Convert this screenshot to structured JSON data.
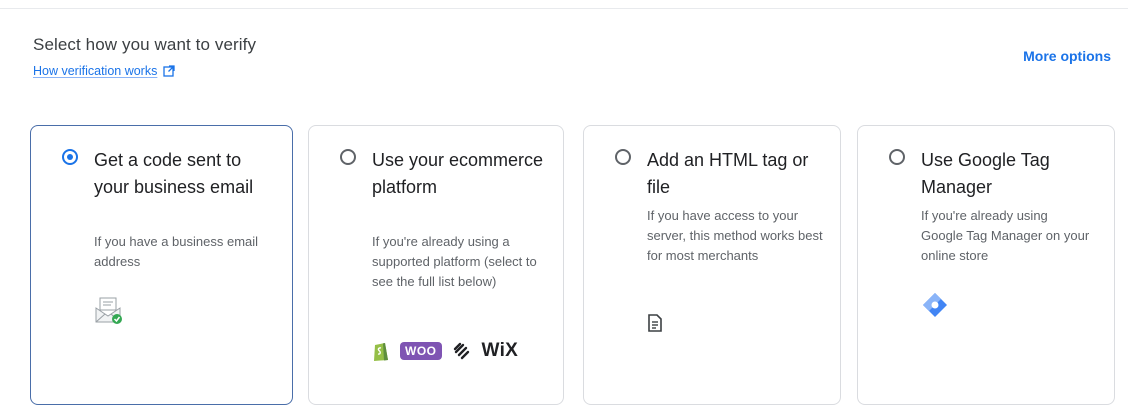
{
  "header": {
    "heading": "Select how you want to verify",
    "how_link": "How verification works",
    "more_options": "More options"
  },
  "options": [
    {
      "title": "Get a code sent to your business email",
      "description": "If you have a business email address",
      "selected": true,
      "icon": "email-envelope-icon"
    },
    {
      "title": "Use your ecommerce platform",
      "description": "If you're already using a supported platform (select to see the full list below)",
      "selected": false,
      "platforms": [
        "shopify-icon",
        "WOO",
        "squarespace-icon",
        "WiX"
      ]
    },
    {
      "title": "Add an HTML tag or file",
      "description": "If you have access to your server, this method works best for most merchants",
      "selected": false,
      "icon": "document-icon"
    },
    {
      "title": "Use Google Tag Manager",
      "description": "If you're already using Google Tag Manager on your online store",
      "selected": false,
      "icon": "google-tag-manager-icon"
    }
  ],
  "colors": {
    "accent": "#1a73e8",
    "selected_border": "#4a6ea9",
    "woo_purple": "#7f54b3",
    "shopify_green": "#95bf47",
    "gtm_blue": "#4285f4"
  }
}
